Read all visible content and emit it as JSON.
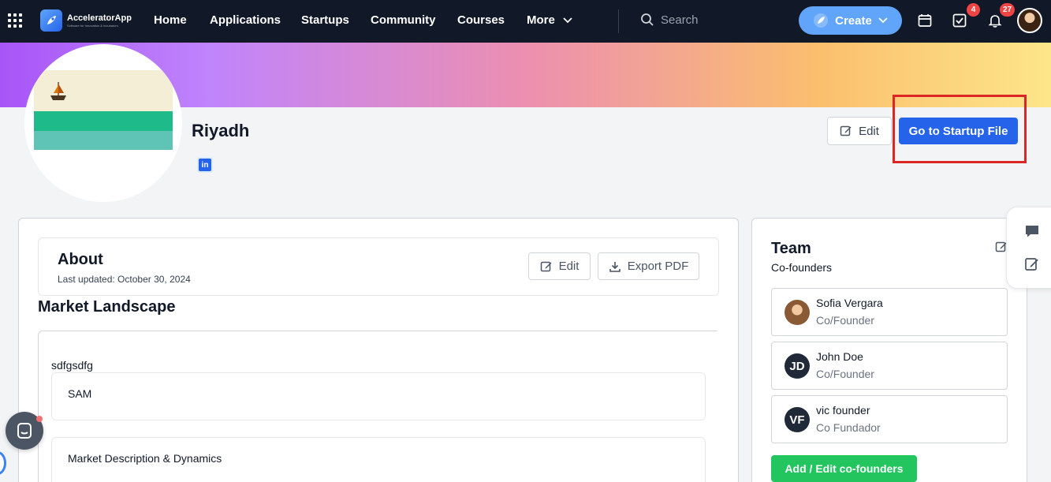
{
  "nav": {
    "brand": "AcceleratorApp",
    "brand_tagline": "Software for Innovation & Incubators",
    "links": [
      "Home",
      "Applications",
      "Startups",
      "Community",
      "Courses",
      "More"
    ],
    "search_placeholder": "Search",
    "create_label": "Create",
    "tasks_badge": "4",
    "notifications_badge": "27"
  },
  "profile": {
    "name": "Riyadh",
    "edit_label": "Edit",
    "startup_file_label": "Go to Startup File"
  },
  "about": {
    "title": "About",
    "last_updated": "Last updated: October 30, 2024",
    "edit_label": "Edit",
    "export_label": "Export PDF"
  },
  "market": {
    "section_title": "Market Landscape",
    "text": "sdfgsdfg",
    "subsections": [
      "SAM",
      "Market Description & Dynamics"
    ]
  },
  "team": {
    "title": "Team",
    "subtitle": "Co-founders",
    "members": [
      {
        "name": "Sofia Vergara",
        "role": "Co/Founder",
        "initials": ""
      },
      {
        "name": "John Doe",
        "role": "Co/Founder",
        "initials": "JD"
      },
      {
        "name": "vic founder",
        "role": "Co Fundador",
        "initials": "VF"
      }
    ],
    "add_label": "Add / Edit co-founders"
  },
  "colors": {
    "primary": "#2563eb",
    "create": "#60a5fa",
    "success": "#22c55e",
    "badge": "#ef4444",
    "highlight": "#dc2626",
    "nav_bg": "#111827"
  }
}
